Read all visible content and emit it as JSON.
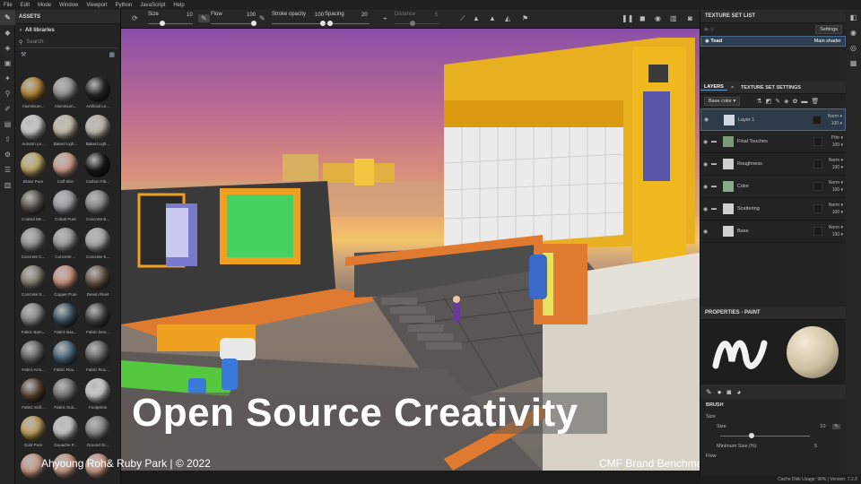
{
  "menu": [
    "File",
    "Edit",
    "Mode",
    "Window",
    "Viewport",
    "Python",
    "JavaScript",
    "Help"
  ],
  "toolbar": {
    "size_label": "Size",
    "size_value": "10",
    "flow_label": "Flow",
    "flow_value": "100",
    "stroke_opacity_label": "Stroke opacity",
    "stroke_opacity_value": "100",
    "spacing_label": "Spacing",
    "spacing_value": "20",
    "distance_label": "Distance",
    "distance_value": "5"
  },
  "assets": {
    "title": "ASSETS",
    "library": "All libraries",
    "search_placeholder": "Search",
    "items": [
      {
        "label": "Aluminium...",
        "color": "#b88a3a"
      },
      {
        "label": "Aluminium...",
        "color": "#9a9a9a"
      },
      {
        "label": "Artificial Le...",
        "color": "#2a2a2a"
      },
      {
        "label": "Autumn Le...",
        "color": "#d8d8d8"
      },
      {
        "label": "Baked Ligh...",
        "color": "#d2c7b6"
      },
      {
        "label": "Baked Ligh...",
        "color": "#c9c3b8"
      },
      {
        "label": "Brass Pure",
        "color": "#c9b26a"
      },
      {
        "label": "Calf Skin",
        "color": "#d9a592"
      },
      {
        "label": "Carbon Fib...",
        "color": "#1c1c1c"
      },
      {
        "label": "Coated Me...",
        "color": "#5d5a52"
      },
      {
        "label": "Cobalt Pure",
        "color": "#a8a8ac"
      },
      {
        "label": "Concrete B...",
        "color": "#8e8e8e"
      },
      {
        "label": "Concrete C...",
        "color": "#9a9a9a"
      },
      {
        "label": "Concrete ...",
        "color": "#a2a2a2"
      },
      {
        "label": "Concrete S...",
        "color": "#b2b2b2"
      },
      {
        "label": "Concrete S...",
        "color": "#8a8276"
      },
      {
        "label": "Copper Pure",
        "color": "#d79a86"
      },
      {
        "label": "Denim Rivet",
        "color": "#6e5a48"
      },
      {
        "label": "Fabric Bam...",
        "color": "#8c8c8c"
      },
      {
        "label": "Fabric Bas...",
        "color": "#3e5666"
      },
      {
        "label": "Fabric Den...",
        "color": "#4a4a4a"
      },
      {
        "label": "Fabric Knit...",
        "color": "#6a6a6a"
      },
      {
        "label": "Fabric Rou...",
        "color": "#4f6b82"
      },
      {
        "label": "Fabric Rou...",
        "color": "#6a6a6a"
      },
      {
        "label": "Fabric Soft...",
        "color": "#5a4636"
      },
      {
        "label": "Fabric Suit...",
        "color": "#7a7a7a"
      },
      {
        "label": "Footprints",
        "color": "#d8d8d8"
      },
      {
        "label": "Gold Pure",
        "color": "#c9a860"
      },
      {
        "label": "Gouache P...",
        "color": "#d0d0d0"
      },
      {
        "label": "Ground Gr...",
        "color": "#8a8a8a"
      },
      {
        "label": "",
        "color": "#d6a28f"
      },
      {
        "label": "",
        "color": "#d6a28f"
      },
      {
        "label": "",
        "color": "#d6a28f"
      }
    ]
  },
  "texture_set_list": {
    "title": "TEXTURE SET LIST",
    "settings_label": "Settings",
    "set_name": "Toad",
    "shader": "Main shader"
  },
  "layers_panel": {
    "tab_layers": "LAYERS",
    "tab_settings": "TEXTURE SET SETTINGS",
    "channel": "Base color",
    "layers": [
      {
        "name": "Layer 1",
        "blend": "Norm",
        "opacity": "100",
        "thumb": "#d0d8e6",
        "folder": false
      },
      {
        "name": "Final Touches",
        "blend": "Pthr",
        "opacity": "100",
        "thumb": "#7a9a7a",
        "folder": true
      },
      {
        "name": "Roughness",
        "blend": "Norm",
        "opacity": "100",
        "thumb": "#d0d0d0",
        "folder": true
      },
      {
        "name": "Color",
        "blend": "Norm",
        "opacity": "100",
        "thumb": "#88aa88",
        "folder": true
      },
      {
        "name": "Scattering",
        "blend": "Norm",
        "opacity": "100",
        "thumb": "#d0d0d0",
        "folder": true
      },
      {
        "name": "Base",
        "blend": "Norm",
        "opacity": "100",
        "thumb": "#d0d0d0",
        "folder": false
      }
    ]
  },
  "properties": {
    "title": "PROPERTIES - PAINT",
    "section": "BRUSH",
    "size_label": "Size",
    "size_row_label": "Size",
    "size_value": "10",
    "min_size_label": "Minimum Size (%)",
    "min_size_value": "5",
    "flow_label": "Flow"
  },
  "status": "Cache Disk Usage: 96% | Version: 7.2.0",
  "overlay": {
    "headline": "Open Source Creativity",
    "authors": "Ahyoung Roh& Ruby Park    |    © 2022",
    "footer_right": "CMF Brand Benchmarking"
  }
}
